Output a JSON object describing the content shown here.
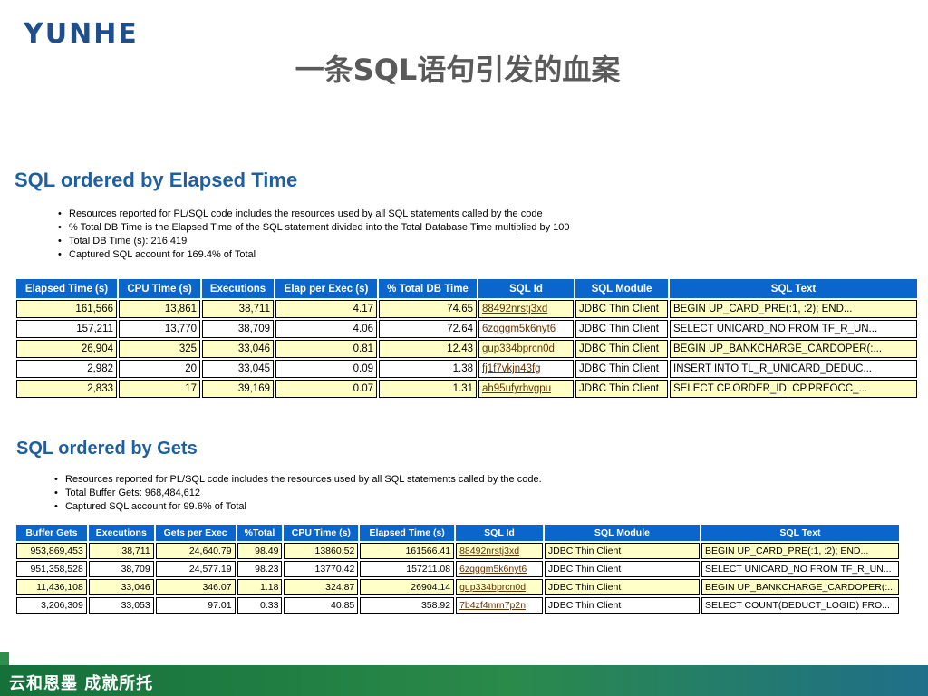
{
  "header": {
    "logo": "YUNHE",
    "title": "一条SQL语句引发的血案"
  },
  "section1": {
    "title": "SQL ordered by Elapsed Time",
    "notes": [
      "Resources reported for PL/SQL code includes the resources used by all SQL statements called by the code",
      "% Total DB Time is the Elapsed Time of the SQL statement divided into the Total Database Time multiplied by 100",
      "Total DB Time (s): 216,419",
      "Captured SQL account for 169.4% of Total"
    ],
    "columns": [
      "Elapsed Time (s)",
      "CPU Time (s)",
      "Executions",
      "Elap per Exec (s)",
      "% Total DB Time",
      "SQL Id",
      "SQL Module",
      "SQL Text"
    ],
    "rows": [
      [
        "161,566",
        "13,861",
        "38,711",
        "4.17",
        "74.65",
        "88492nrstj3xd",
        "JDBC Thin Client",
        "BEGIN UP_CARD_PRE(:1, :2); END..."
      ],
      [
        "157,211",
        "13,770",
        "38,709",
        "4.06",
        "72.64",
        "6zqggm5k6nyt6",
        "JDBC Thin Client",
        "SELECT UNICARD_NO FROM TF_R_UN..."
      ],
      [
        "26,904",
        "325",
        "33,046",
        "0.81",
        "12.43",
        "gup334bprcn0d",
        "JDBC Thin Client",
        "BEGIN UP_BANKCHARGE_CARDOPER(:..."
      ],
      [
        "2,982",
        "20",
        "33,045",
        "0.09",
        "1.38",
        "fj1f7vkjn43fg",
        "JDBC Thin Client",
        "INSERT INTO TL_R_UNICARD_DEDUC..."
      ],
      [
        "2,833",
        "17",
        "39,169",
        "0.07",
        "1.31",
        "ah95ufyrbvgpu",
        "JDBC Thin Client",
        "SELECT CP.ORDER_ID, CP.PREOCC_..."
      ]
    ]
  },
  "section2": {
    "title": "SQL ordered by Gets",
    "notes": [
      "Resources reported for PL/SQL code includes the resources used by all SQL statements called by the code.",
      "Total Buffer Gets: 968,484,612",
      "Captured SQL account for 99.6% of Total"
    ],
    "columns": [
      "Buffer Gets",
      "Executions",
      "Gets per Exec",
      "%Total",
      "CPU Time (s)",
      "Elapsed Time (s)",
      "SQL Id",
      "SQL Module",
      "SQL Text"
    ],
    "rows": [
      [
        "953,869,453",
        "38,711",
        "24,640.79",
        "98.49",
        "13860.52",
        "161566.41",
        "88492nrstj3xd",
        "JDBC Thin Client",
        "BEGIN UP_CARD_PRE(:1, :2); END..."
      ],
      [
        "951,358,528",
        "38,709",
        "24,577.19",
        "98.23",
        "13770.42",
        "157211.08",
        "6zqggm5k6nyt6",
        "JDBC Thin Client",
        "SELECT UNICARD_NO FROM TF_R_UN..."
      ],
      [
        "11,436,108",
        "33,046",
        "346.07",
        "1.18",
        "324.87",
        "26904.14",
        "gup334bprcn0d",
        "JDBC Thin Client",
        "BEGIN UP_BANKCHARGE_CARDOPER(:..."
      ],
      [
        "3,206,309",
        "33,053",
        "97.01",
        "0.33",
        "40.85",
        "358.92",
        "7b4zf4mrn7p2n",
        "JDBC Thin Client",
        "SELECT COUNT(DEDUCT_LOGID) FRO..."
      ]
    ]
  },
  "footer": {
    "text": "云和恩墨 成就所托"
  },
  "colors": {
    "header_bg": "#0a66cc",
    "highlight_row": "#ffffc8",
    "section_title": "#1f5f9f",
    "footer_green": "#15703a"
  }
}
